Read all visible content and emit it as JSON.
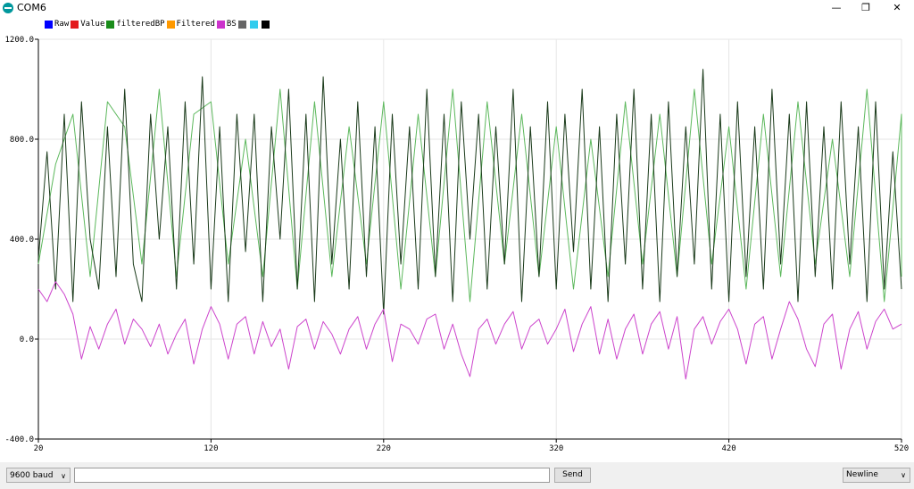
{
  "window": {
    "title": "COM6",
    "minimize_glyph": "—",
    "restore_glyph": "❐",
    "close_glyph": "✕"
  },
  "legend": [
    {
      "label": "Raw",
      "color": "#0000ff"
    },
    {
      "label": "Value",
      "color": "#e31a1c"
    },
    {
      "label": "filteredBP",
      "color": "#1a8c1a"
    },
    {
      "label": "Filtered",
      "color": "#ff9900"
    },
    {
      "label": "BS",
      "color": "#cc33cc"
    },
    {
      "label": "",
      "color": "#666666"
    },
    {
      "label": "",
      "color": "#33ccee"
    },
    {
      "label": "",
      "color": "#000000"
    }
  ],
  "chart_data": {
    "type": "line",
    "xlim": [
      20,
      520
    ],
    "ylim": [
      -400,
      1200
    ],
    "x_ticks": [
      "20",
      "120",
      "220",
      "320",
      "420",
      "520"
    ],
    "y_ticks": [
      "-400.0",
      "0.0",
      "400.0",
      "800.0",
      "1200.0"
    ],
    "grid": true,
    "legend_position": "top-left",
    "series": [
      {
        "color": "#5cb85c",
        "x_start": 20,
        "x_step": 10,
        "values": [
          300,
          700,
          900,
          250,
          950,
          850,
          300,
          1000,
          250,
          900,
          950,
          300,
          800,
          250,
          1000,
          200,
          950,
          250,
          850,
          300,
          950,
          200,
          900,
          250,
          1000,
          150,
          950,
          300,
          900,
          250,
          850,
          200,
          800,
          250,
          950,
          300,
          900,
          250,
          1000,
          300,
          850,
          200,
          900,
          250,
          950,
          300,
          800,
          250,
          1000,
          150,
          900,
          250
        ]
      },
      {
        "color": "#1a3a1a",
        "x_start": 20,
        "x_step": 5,
        "values": [
          320,
          750,
          200,
          900,
          150,
          950,
          400,
          200,
          850,
          250,
          1000,
          300,
          150,
          900,
          400,
          850,
          200,
          950,
          300,
          1050,
          200,
          850,
          150,
          900,
          350,
          900,
          150,
          850,
          400,
          1000,
          200,
          900,
          150,
          1050,
          300,
          800,
          200,
          950,
          250,
          850,
          100,
          900,
          300,
          850,
          200,
          1000,
          250,
          900,
          150,
          950,
          400,
          900,
          200,
          850,
          300,
          1000,
          150,
          850,
          250,
          950,
          200,
          900,
          350,
          1000,
          200,
          850,
          150,
          900,
          300,
          1000,
          200,
          900,
          150,
          950,
          250,
          850,
          300,
          1080,
          200,
          900,
          150,
          950,
          250,
          850,
          200,
          1000,
          300,
          900,
          150,
          950,
          250,
          850,
          200,
          950,
          300,
          850,
          150,
          950,
          200,
          750,
          200
        ]
      },
      {
        "color": "#cc44cc",
        "x_start": 20,
        "x_step": 5,
        "values": [
          200,
          150,
          230,
          180,
          100,
          -80,
          50,
          -40,
          60,
          120,
          -20,
          80,
          40,
          -30,
          60,
          -60,
          20,
          80,
          -100,
          40,
          130,
          60,
          -80,
          60,
          90,
          -60,
          70,
          -30,
          40,
          -120,
          50,
          80,
          -40,
          70,
          20,
          -60,
          40,
          90,
          -40,
          60,
          120,
          -90,
          60,
          40,
          -20,
          80,
          100,
          -40,
          60,
          -60,
          -150,
          40,
          80,
          -20,
          60,
          110,
          -40,
          50,
          80,
          -20,
          40,
          120,
          -50,
          60,
          130,
          -60,
          80,
          -80,
          40,
          100,
          -60,
          60,
          110,
          -40,
          90,
          -160,
          40,
          90,
          -20,
          70,
          120,
          40,
          -100,
          60,
          90,
          -80,
          40,
          150,
          80,
          -40,
          -110,
          60,
          100,
          -120,
          40,
          110,
          -40,
          70,
          120,
          40,
          60
        ]
      }
    ]
  },
  "controls": {
    "baud": "9600 baud",
    "send_input_value": "",
    "send_label": "Send",
    "line_ending": "Newline",
    "dropdown_glyph": "∨"
  }
}
